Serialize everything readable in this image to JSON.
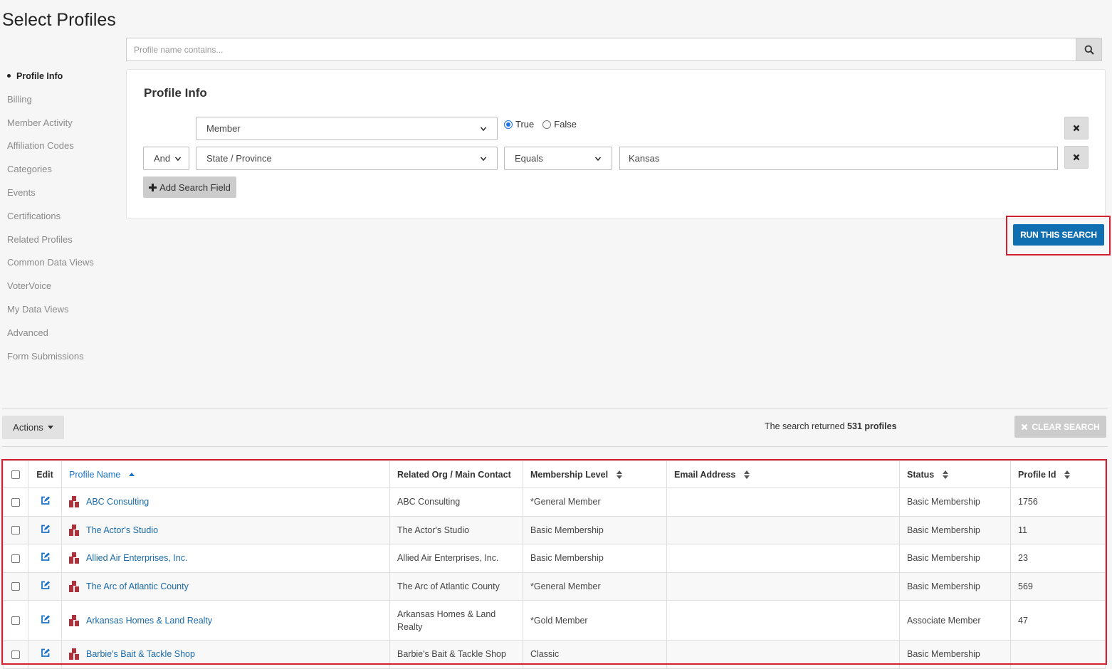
{
  "page": {
    "title": "Select Profiles"
  },
  "search": {
    "placeholder": "Profile name contains..."
  },
  "sidebar": {
    "items": [
      {
        "label": "Profile Info",
        "active": true
      },
      {
        "label": "Billing"
      },
      {
        "label": "Member Activity"
      },
      {
        "label": "Affiliation Codes"
      },
      {
        "label": "Categories"
      },
      {
        "label": "Events"
      },
      {
        "label": "Certifications"
      },
      {
        "label": "Related Profiles"
      },
      {
        "label": "Common Data Views"
      },
      {
        "label": "VoterVoice"
      },
      {
        "label": "My Data Views"
      },
      {
        "label": "Advanced"
      },
      {
        "label": "Form Submissions"
      }
    ]
  },
  "panel": {
    "title": "Profile Info",
    "row1": {
      "field": "Member",
      "radio_true": "True",
      "radio_false": "False",
      "selected": "True"
    },
    "row2": {
      "conjunction": "And",
      "field": "State / Province",
      "operator": "Equals",
      "value": "Kansas"
    },
    "add_field_label": "Add Search Field"
  },
  "run_search_label": "RUN THIS SEARCH",
  "actions_label": "Actions",
  "results": {
    "prefix": "The search returned",
    "count": "531 profiles"
  },
  "clear_search_label": "CLEAR SEARCH",
  "table": {
    "headers": {
      "edit": "Edit",
      "profile_name": "Profile Name",
      "related_org": "Related Org / Main Contact",
      "membership_level": "Membership Level",
      "email": "Email Address",
      "status": "Status",
      "profile_id": "Profile Id"
    },
    "rows": [
      {
        "name": "ABC Consulting",
        "related": "ABC Consulting",
        "level": "*General Member",
        "email": "",
        "status": "Basic Membership",
        "id": "1756"
      },
      {
        "name": "The Actor's Studio",
        "related": "The Actor's Studio",
        "level": "Basic Membership",
        "email": "",
        "status": "Basic Membership",
        "id": "11"
      },
      {
        "name": "Allied Air Enterprises, Inc.",
        "related": "Allied Air Enterprises, Inc.",
        "level": "Basic Membership",
        "email": "",
        "status": "Basic Membership",
        "id": "23"
      },
      {
        "name": "The Arc of Atlantic County",
        "related": "The Arc of Atlantic County",
        "level": "*General Member",
        "email": "",
        "status": "Basic Membership",
        "id": "569"
      },
      {
        "name": "Arkansas Homes & Land Realty",
        "related": "Arkansas Homes & Land Realty",
        "level": "*Gold Member",
        "email": "",
        "status": "Associate Member",
        "id": "47"
      },
      {
        "name": "Barbie's Bait & Tackle Shop",
        "related": "Barbie's Bait & Tackle Shop",
        "level": "Classic",
        "email": "",
        "status": "Basic Membership",
        "id": ""
      }
    ]
  },
  "colors": {
    "accent": "#0f6fb0",
    "link": "#1a6aa8",
    "highlight": "#d32030",
    "profile_icon": "#b0303a"
  }
}
